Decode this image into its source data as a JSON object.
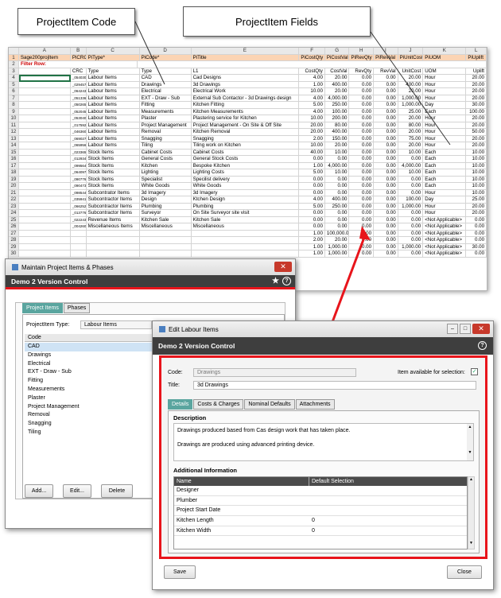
{
  "callouts": {
    "code": "ProjectItem Code",
    "fields": "ProjectItem Fields"
  },
  "sheet": {
    "col_letters": [
      "A",
      "B",
      "C",
      "D",
      "E",
      "F",
      "G",
      "H",
      "I",
      "J",
      "K",
      "L"
    ],
    "row1": [
      "Sage200projItem",
      "PiCRC",
      "PiType*",
      "PiCode*",
      "PiTitle",
      "PiCostQty",
      "PiCostVal",
      "PiRevQty",
      "PiRevVal",
      "PiUnitCost",
      "PiUOM",
      "PiUplift"
    ],
    "row2_label": "Filter Row:",
    "row3": [
      "",
      "CRC",
      "Type",
      "Type",
      "L1",
      "CostQty",
      "CostVal",
      "RevQty",
      "RevVal",
      "UnitCost",
      "UOM",
      "Uplift"
    ],
    "rows": [
      [
        "4",
        "",
        "_054030",
        "Labour Items",
        "CAD",
        "Cad Designs",
        "4.00",
        "20.00",
        "0.00",
        "0.00",
        "20.00",
        "Hour",
        "20.00"
      ],
      [
        "5",
        "",
        "_029457",
        "Labour Items",
        "Drawings",
        "3d Drawings",
        "1.00",
        "400.00",
        "0.00",
        "0.00",
        "400.00",
        "Hour",
        "20.00"
      ],
      [
        "6",
        "",
        "_064243",
        "Labour Items",
        "Electrical",
        "Electrical Work",
        "10.00",
        "20.00",
        "0.00",
        "0.00",
        "20.00",
        "Hour",
        "20.00"
      ],
      [
        "7",
        "",
        "_051336",
        "Labour Items",
        "EXT - Draw - Sub",
        "External Sub Contactor - 3d Drawings design",
        "4.00",
        "4,000.00",
        "0.00",
        "0.00",
        "1,000.00",
        "Hour",
        "20.00"
      ],
      [
        "8",
        "",
        "_050265",
        "Labour Items",
        "Fitting",
        "Kitchen Fitting",
        "5.00",
        "250.00",
        "0.00",
        "0.00",
        "1,000.00",
        "Day",
        "30.00"
      ],
      [
        "9",
        "",
        "_052045",
        "Labour Items",
        "Measurements",
        "Kitchen Measurements",
        "4.00",
        "100.00",
        "0.00",
        "0.00",
        "25.00",
        "Each",
        "100.00"
      ],
      [
        "10",
        "",
        "_053040",
        "Labour Items",
        "Plaster",
        "Plastering service for Kitchen",
        "10.00",
        "200.00",
        "0.00",
        "0.00",
        "20.00",
        "Hour",
        "20.00"
      ],
      [
        "11",
        "",
        "_017592",
        "Labour Items",
        "Project Management",
        "Project Management - On Site & Off Site",
        "20.00",
        "80.00",
        "0.00",
        "0.00",
        "80.00",
        "Hour",
        "20.00"
      ],
      [
        "12",
        "",
        "_046360",
        "Labour Items",
        "Removal",
        "Kitchen Removal",
        "20.00",
        "400.00",
        "0.00",
        "0.00",
        "20.00",
        "Hour",
        "50.00"
      ],
      [
        "13",
        "",
        "_069027",
        "Labour Items",
        "Snagging",
        "Snagging",
        "2.00",
        "150.00",
        "0.00",
        "0.00",
        "75.00",
        "Hour",
        "20.00"
      ],
      [
        "14",
        "",
        "_065956",
        "Labour Items",
        "Tiling",
        "Tiling work on Kitchen",
        "10.00",
        "20.00",
        "0.00",
        "0.00",
        "20.00",
        "Hour",
        "20.00"
      ],
      [
        "15",
        "",
        "_023365",
        "Stock Items",
        "Cabinet Costs",
        "Cabinet Costs",
        "40.00",
        "10.00",
        "0.00",
        "0.00",
        "10.00",
        "Each",
        "10.00"
      ],
      [
        "16",
        "",
        "_012934",
        "Stock Items",
        "General Costs",
        "General Stock Costs",
        "0.00",
        "0.00",
        "0.00",
        "0.00",
        "0.00",
        "Each",
        "10.00"
      ],
      [
        "17",
        "",
        "_099564",
        "Stock Items",
        "Kitchen",
        "Bespoke Kitchen",
        "1.00",
        "4,000.00",
        "0.00",
        "0.00",
        "4,000.00",
        "Each",
        "10.00"
      ],
      [
        "18",
        "",
        "_064097",
        "Stock Items",
        "Lighting",
        "Lighting Costs",
        "5.00",
        "10.00",
        "0.00",
        "0.00",
        "10.00",
        "Each",
        "10.00"
      ],
      [
        "19",
        "",
        "_090776",
        "Stock Items",
        "Specialist",
        "Specilist delivery",
        "0.00",
        "0.00",
        "0.00",
        "0.00",
        "0.00",
        "Each",
        "10.00"
      ],
      [
        "20",
        "",
        "_090473",
        "Stock Items",
        "White Goods",
        "White Goods",
        "0.00",
        "0.00",
        "0.00",
        "0.00",
        "0.00",
        "Each",
        "10.00"
      ],
      [
        "21",
        "",
        "_098544",
        "Subcontrator Items",
        "3d Imagery",
        "3d Imagery",
        "0.00",
        "0.00",
        "0.00",
        "0.00",
        "0.00",
        "Hour",
        "10.00"
      ],
      [
        "22",
        "",
        "_035941",
        "Subcontractor Items",
        "Design",
        "Ktchen Design",
        "4.00",
        "400.00",
        "0.00",
        "0.00",
        "100.00",
        "Day",
        "25.00"
      ],
      [
        "23",
        "",
        "_066252",
        "Subcontractor Items",
        "Plumbing",
        "Plumbing",
        "5.00",
        "250.00",
        "0.00",
        "0.00",
        "1,000.00",
        "Hour",
        "20.00"
      ],
      [
        "24",
        "",
        "_013776",
        "Subcontractor Items",
        "Surveyor",
        "On Site Surveyor site visit",
        "0.00",
        "0.00",
        "0.00",
        "0.00",
        "0.00",
        "Hour",
        "20.00"
      ],
      [
        "25",
        "",
        "_022243",
        "Revenue Items",
        "Kitchen Sale",
        "Kitchen Sale",
        "0.00",
        "0.00",
        "0.00",
        "0.00",
        "0.00",
        "<Not Applicable>",
        "0.00"
      ],
      [
        "26",
        "",
        "_004260",
        "Miscellaneous Items",
        "Miscellaneous",
        "Miscellaneous",
        "0.00",
        "0.00",
        "0.00",
        "0.00",
        "0.00",
        "<Not Applicable>",
        "0.00"
      ],
      [
        "27",
        "",
        "",
        "",
        "",
        "",
        "1.00",
        "100,000.00",
        "0.00",
        "0.00",
        "0.00",
        "<Not Applicable>",
        "0.00"
      ],
      [
        "28",
        "",
        "",
        "",
        "",
        "",
        "2.00",
        "20.00",
        "0.00",
        "0.00",
        "0.00",
        "<Not Applicable>",
        "0.00"
      ],
      [
        "29",
        "",
        "",
        "",
        "",
        "",
        "1.00",
        "1,000.00",
        "0.00",
        "0.00",
        "1,000.00",
        "<Not Applicable>",
        "30.00"
      ],
      [
        "30",
        "",
        "",
        "",
        "",
        "",
        "1.00",
        "1,000.00",
        "0.00",
        "0.00",
        "0.00",
        "<Not Applicable>",
        "0.00"
      ]
    ]
  },
  "maintain": {
    "window_title": "Maintain Project Items & Phases",
    "subtitle": "Demo 2 Version Control",
    "tabs": [
      "Project Items",
      "Phases"
    ],
    "type_label": "ProjectItem Type:",
    "type_value": "Labour Items",
    "code_header": "Code",
    "codes": [
      "CAD",
      "Drawings",
      "Electrical",
      "EXT - Draw - Sub",
      "Fitting",
      "Measurements",
      "Plaster",
      "Project Management",
      "Removal",
      "Snagging",
      "Tiling"
    ],
    "buttons": [
      "Add...",
      "Edit...",
      "Delete"
    ]
  },
  "edit": {
    "window_title": "Edit Labour Items",
    "subtitle": "Demo 2 Version Control",
    "code_label": "Code:",
    "code_value": "Drawings",
    "available_label": "Item available for selection:",
    "available_checked": true,
    "title_label": "Title:",
    "title_value": "3d Drawings",
    "tabs": [
      "Details",
      "Costs & Charges",
      "Nominal Defaults",
      "Attachments"
    ],
    "description_label": "Description",
    "description_lines": [
      "Drawings produced based from Cas design work that has taken place.",
      "",
      "Drawings are produced using advanced printing device."
    ],
    "additional_label": "Additional Information",
    "grid_headers": [
      "Name",
      "Default Selection"
    ],
    "grid_rows": [
      [
        "Designer",
        ""
      ],
      [
        "Plumber",
        ""
      ],
      [
        "Project Start Date",
        ""
      ],
      [
        "Kitchen Length",
        "0"
      ],
      [
        "Kitchen Width",
        "0"
      ]
    ],
    "save": "Save",
    "close": "Close"
  },
  "colors": {
    "highlight_red": "#e8141b",
    "orange_header": "#fbd4b4",
    "teal_tab": "#5aa59f",
    "dark_bar": "#3e3e3e"
  }
}
